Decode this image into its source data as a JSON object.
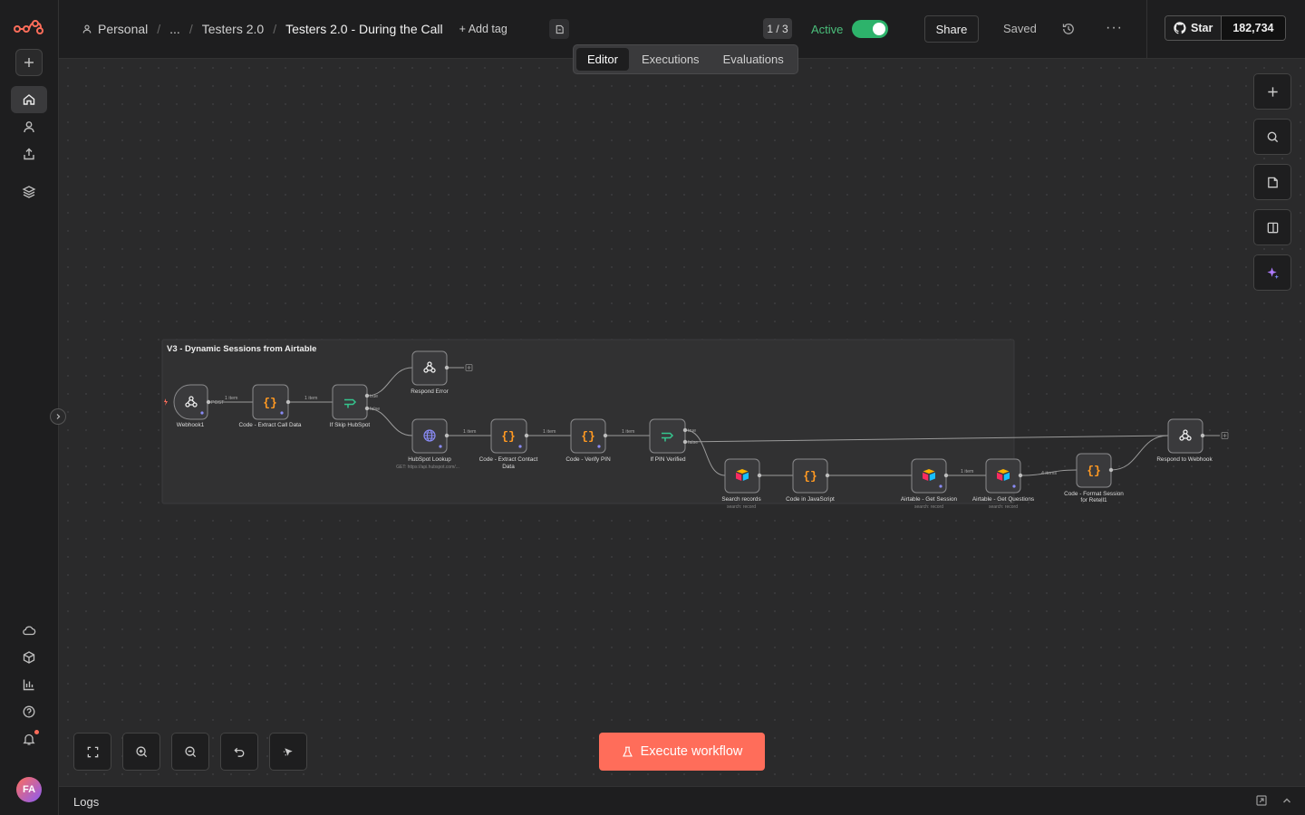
{
  "breadcrumbs": {
    "project": "Personal",
    "ellipsis": "...",
    "folder": "Testers 2.0",
    "workflow": "Testers 2.0 - During the Call",
    "add_tag": "+ Add tag"
  },
  "header": {
    "counter": "1 / 3",
    "active_label": "Active",
    "active": true,
    "share": "Share",
    "saved": "Saved",
    "github_star": "Star",
    "github_count": "182,734"
  },
  "tabs": [
    {
      "label": "Editor",
      "active": true
    },
    {
      "label": "Executions",
      "active": false
    },
    {
      "label": "Evaluations",
      "active": false
    }
  ],
  "user": {
    "initials": "FA"
  },
  "execute_button": "Execute workflow",
  "logs": {
    "title": "Logs"
  },
  "icons": {
    "sidebar_top": [
      "n8n-logo-icon",
      "plus-icon",
      "home-icon",
      "user-icon",
      "share-icon",
      "layers-icon"
    ],
    "sidebar_bottom": [
      "cloud-icon",
      "templates-icon",
      "insights-icon",
      "help-icon",
      "bell-icon"
    ],
    "right_toolbar": [
      "plus-icon",
      "search-icon",
      "sticky-note-icon",
      "panel-icon",
      "sparkle-icon"
    ],
    "bottom_toolbar": [
      "fit-view-icon",
      "zoom-in-icon",
      "zoom-out-icon",
      "undo-icon",
      "pointer-icon"
    ]
  },
  "colors": {
    "accent": "#ff6d5a",
    "active_green": "#2db36b",
    "code_node": "#ff9922",
    "if_node": "#35c58e",
    "http_node": "#8a8cf7"
  },
  "workflow": {
    "group_title": "V3 - Dynamic Sessions from Airtable",
    "nodes": [
      {
        "id": "webhook",
        "label": "Webhook1",
        "icon": "webhook-icon"
      },
      {
        "id": "extract_call",
        "label": "Code - Extract Call Data",
        "icon": "code-icon"
      },
      {
        "id": "if_skip",
        "label": "If Skip HubSpot",
        "icon": "if-icon"
      },
      {
        "id": "respond_error",
        "label": "Respond Error",
        "icon": "webhook-icon"
      },
      {
        "id": "hubspot",
        "label": "HubSpot Lookup",
        "sub": "GET: https://api.hubspot.com/...",
        "icon": "globe-icon"
      },
      {
        "id": "extract_contact",
        "label": "Code - Extract Contact",
        "label2": "Data",
        "icon": "code-icon"
      },
      {
        "id": "verify_pin",
        "label": "Code - Verify PIN",
        "icon": "code-icon"
      },
      {
        "id": "if_pin",
        "label": "If PIN Verified",
        "icon": "if-icon"
      },
      {
        "id": "search_records",
        "label": "Search records",
        "sub": "search: record",
        "icon": "airtable-icon"
      },
      {
        "id": "code_js",
        "label": "Code in JavaScript",
        "icon": "code-icon"
      },
      {
        "id": "get_session",
        "label": "Airtable - Get Session",
        "sub": "search: record",
        "icon": "airtable-icon"
      },
      {
        "id": "get_questions",
        "label": "Airtable - Get Questions",
        "sub": "search: record",
        "icon": "airtable-icon"
      },
      {
        "id": "format_session",
        "label": "Code - Format Session",
        "label2": "for Retell1",
        "icon": "code-icon"
      },
      {
        "id": "respond_webhook",
        "label": "Respond to Webhook",
        "icon": "webhook-icon"
      }
    ],
    "edge_labels": {
      "webhook_method": "POST",
      "one_item": "1 item",
      "branch_true": "true",
      "branch_false": "false",
      "n_items": "4 items"
    }
  }
}
